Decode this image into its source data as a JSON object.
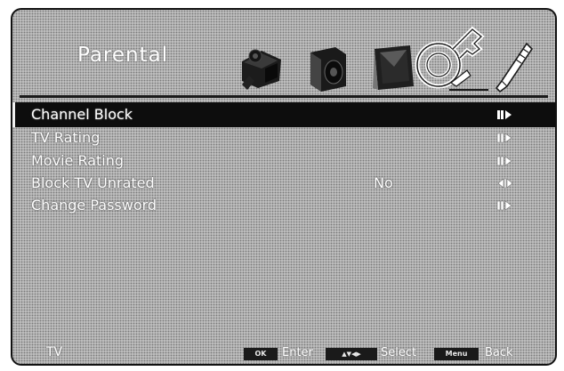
{
  "header": {
    "title": "Parental"
  },
  "tabs": [
    {
      "icon": "camera-icon"
    },
    {
      "icon": "speaker-icon"
    },
    {
      "icon": "picture-icon"
    },
    {
      "icon": "key-icon"
    },
    {
      "icon": "wrench-icon"
    }
  ],
  "menu": {
    "items": [
      {
        "label": "Channel Block",
        "value": ""
      },
      {
        "label": "TV Rating",
        "value": ""
      },
      {
        "label": "Movie Rating",
        "value": ""
      },
      {
        "label": "Block TV Unrated",
        "value": "No"
      },
      {
        "label": "Change Password",
        "value": ""
      }
    ]
  },
  "footer": {
    "source": "TV",
    "ok_button": "OK",
    "ok_hint": "Enter",
    "nav_button": "▲▼◀▶",
    "nav_hint": "Select",
    "menu_button": "Menu",
    "menu_hint": "Back"
  },
  "colors": {
    "background": "#bdbdbd",
    "selected_row": "#0d0d0d",
    "text": "#ffffff"
  }
}
